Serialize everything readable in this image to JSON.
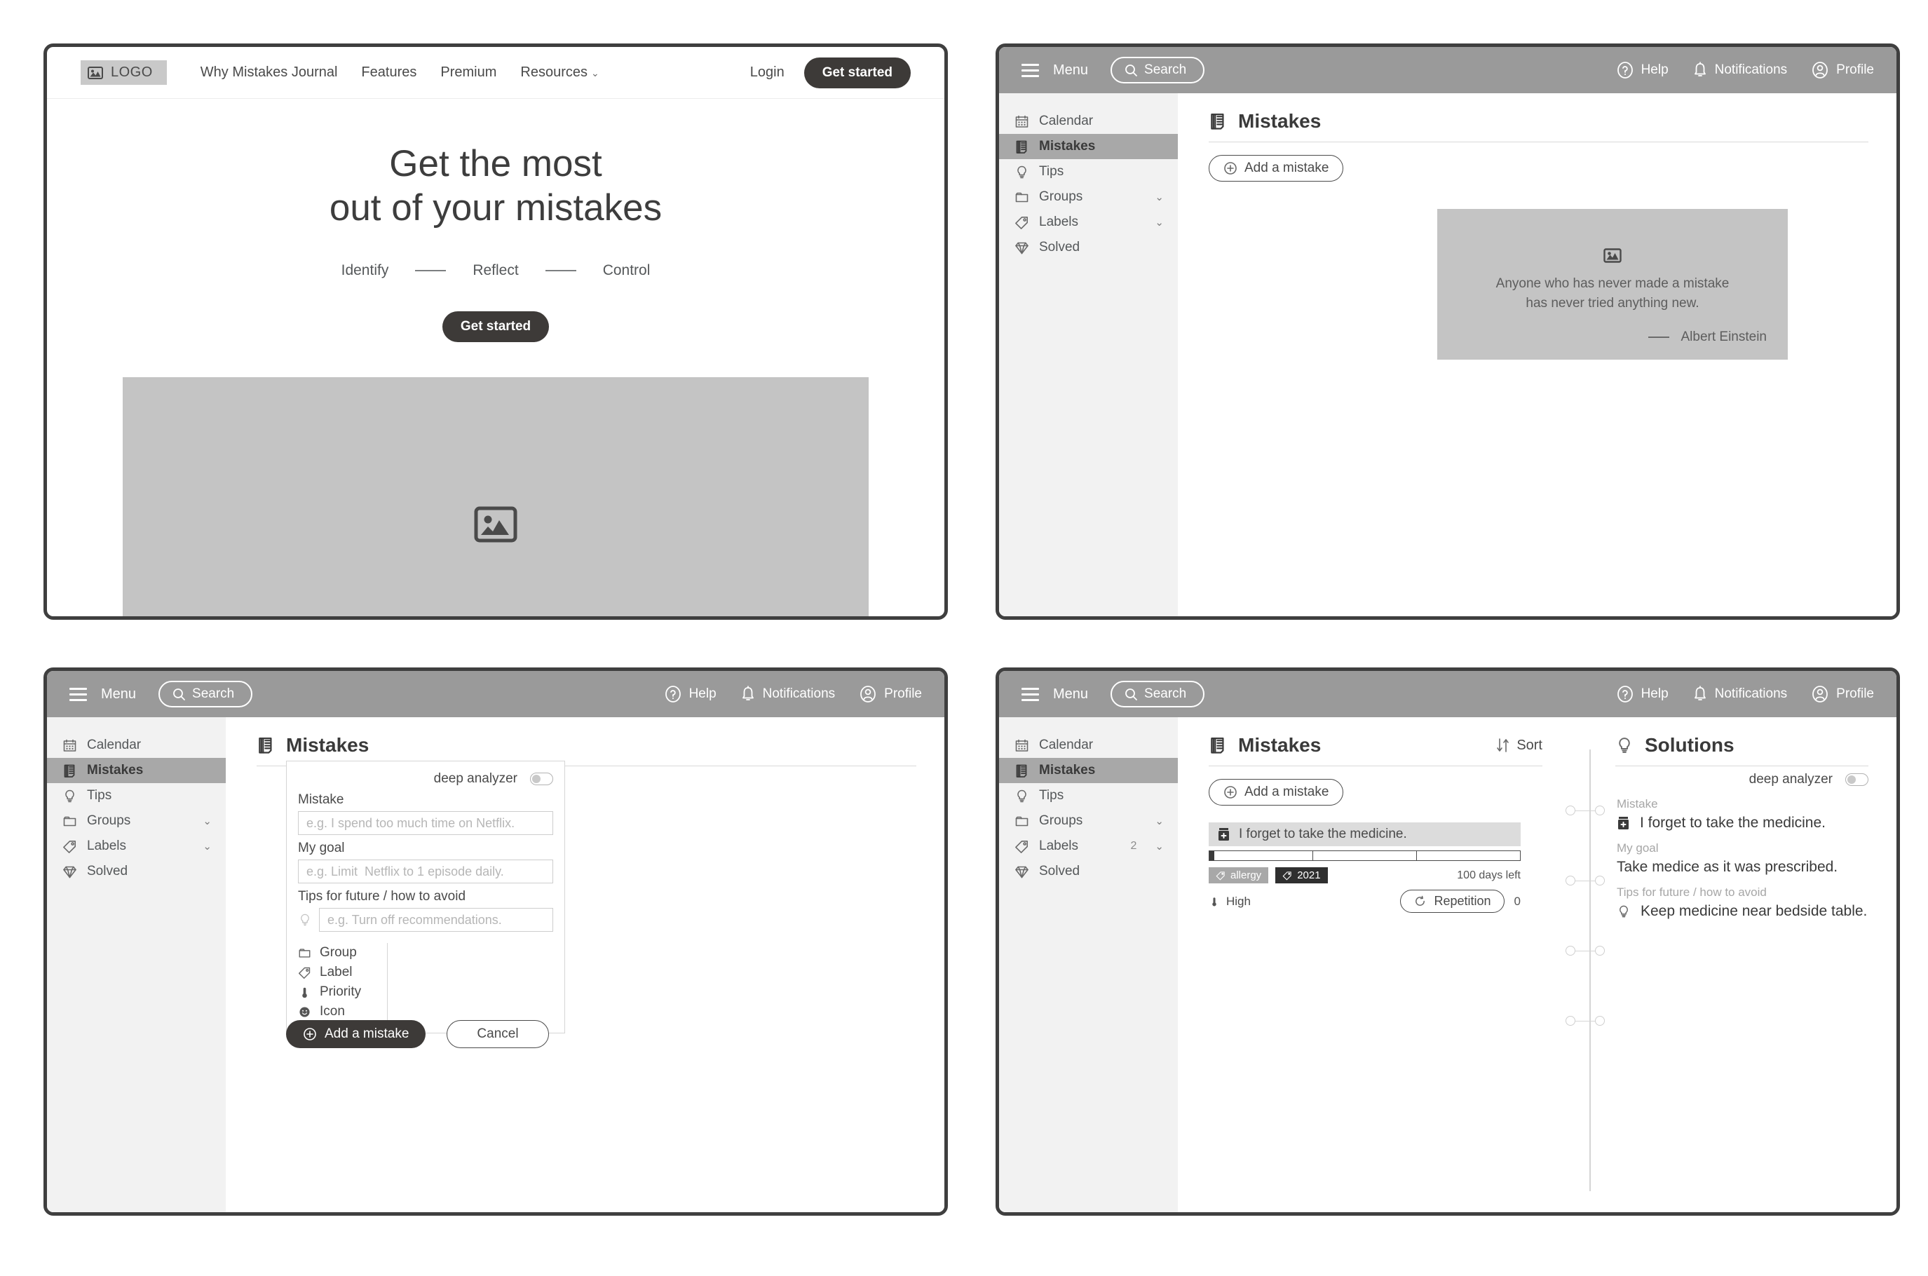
{
  "landing": {
    "logo_text": "LOGO",
    "logo_icon": "image-placeholder-icon",
    "nav_links": [
      "Why Mistakes Journal",
      "Features",
      "Premium",
      "Resources"
    ],
    "resources_chevron": "chevron-down-icon",
    "login_label": "Login",
    "get_started_label": "Get started",
    "hero_line1": "Get the most",
    "hero_line2": "out of your mistakes",
    "steps": [
      "Identify",
      "Reflect",
      "Control"
    ],
    "hero_cta_label": "Get started",
    "hero_placeholder_icon": "image-placeholder-icon"
  },
  "topbar": {
    "menu_label": "Menu",
    "search_label": "Search",
    "help_label": "Help",
    "notifications_label": "Notifications",
    "profile_label": "Profile",
    "bg_color": "#9a9a9a"
  },
  "sidebar": {
    "items": [
      {
        "label": "Calendar",
        "icon": "calendar-icon",
        "active": false
      },
      {
        "label": "Mistakes",
        "icon": "notebook-icon",
        "active": true
      },
      {
        "label": "Tips",
        "icon": "bulb-icon",
        "active": false
      },
      {
        "label": "Groups",
        "icon": "folder-icon",
        "active": false,
        "chevron": "chevron-down-icon"
      },
      {
        "label": "Labels",
        "icon": "tag-icon",
        "active": false,
        "chevron": "chevron-down-icon"
      },
      {
        "label": "Solved",
        "icon": "diamond-icon",
        "active": false
      }
    ],
    "labels_count_detail": "2",
    "active_bg": "#a8a8a8"
  },
  "empty_state": {
    "page_title": "Mistakes",
    "page_icon": "notebook-icon",
    "add_button_label": "Add a mistake",
    "add_button_icon": "plus-circle-icon",
    "quote_icon": "image-placeholder-icon",
    "quote_line1": "Anyone who has never made a mistake",
    "quote_line2": "has never tried anything new.",
    "quote_author": "Albert Einstein",
    "card_bg": "#c4c4c4"
  },
  "form_panel": {
    "page_title": "Mistakes",
    "page_icon": "notebook-icon",
    "deep_analyzer_label": "deep analyzer",
    "deep_analyzer_on": false,
    "mistake_label": "Mistake",
    "mistake_placeholder": "e.g. I spend too much time on Netflix.",
    "mistake_value": "",
    "goal_label": "My goal",
    "goal_placeholder": "e.g. Limit  Netflix to 1 episode daily.",
    "goal_value": "",
    "tips_label": "Tips for future / how to avoid",
    "tips_placeholder": "e.g. Turn off recommendations.",
    "tips_value": "",
    "tips_icon": "bulb-icon",
    "meta_rows": [
      {
        "label": "Group",
        "icon": "folder-icon"
      },
      {
        "label": "Label",
        "icon": "tag-icon"
      },
      {
        "label": "Priority",
        "icon": "thermometer-icon"
      },
      {
        "label": "Icon",
        "icon": "smiley-icon"
      }
    ],
    "submit_label": "Add a mistake",
    "submit_icon": "plus-circle-icon",
    "cancel_label": "Cancel"
  },
  "detail_panel": {
    "mistakes_title": "Mistakes",
    "mistakes_icon": "notebook-icon",
    "sort_label": "Sort",
    "sort_icon": "sort-arrows-icon",
    "add_button_label": "Add a mistake",
    "add_button_icon": "plus-circle-icon",
    "mistake_item": {
      "icon": "medicine-jar-icon",
      "text": "I forget to take the medicine.",
      "progress_segments": 3,
      "progress_fill_percent": 5,
      "labels": [
        {
          "text": "allergy",
          "icon": "tag-icon",
          "style": "gray"
        },
        {
          "text": "2021",
          "icon": "tag-icon",
          "style": "dark"
        }
      ],
      "days_left": "100 days left",
      "priority_label": "High",
      "priority_icon": "thermometer-icon",
      "repetition_label": "Repetition",
      "repetition_icon": "refresh-icon",
      "repetition_count": "0"
    },
    "solutions_title": "Solutions",
    "solutions_icon": "bulb-icon",
    "deep_analyzer_label": "deep analyzer",
    "deep_analyzer_on": false,
    "mistake_field_label": "Mistake",
    "mistake_field_icon": "medicine-jar-icon",
    "mistake_field_value": "I forget to take the medicine.",
    "goal_field_label": "My goal",
    "goal_field_value": "Take medice as it was prescribed.",
    "tips_field_label": "Tips for future / how to avoid",
    "tips_field_icon": "bulb-icon",
    "tips_field_value": "Keep medicine near bedside table."
  }
}
